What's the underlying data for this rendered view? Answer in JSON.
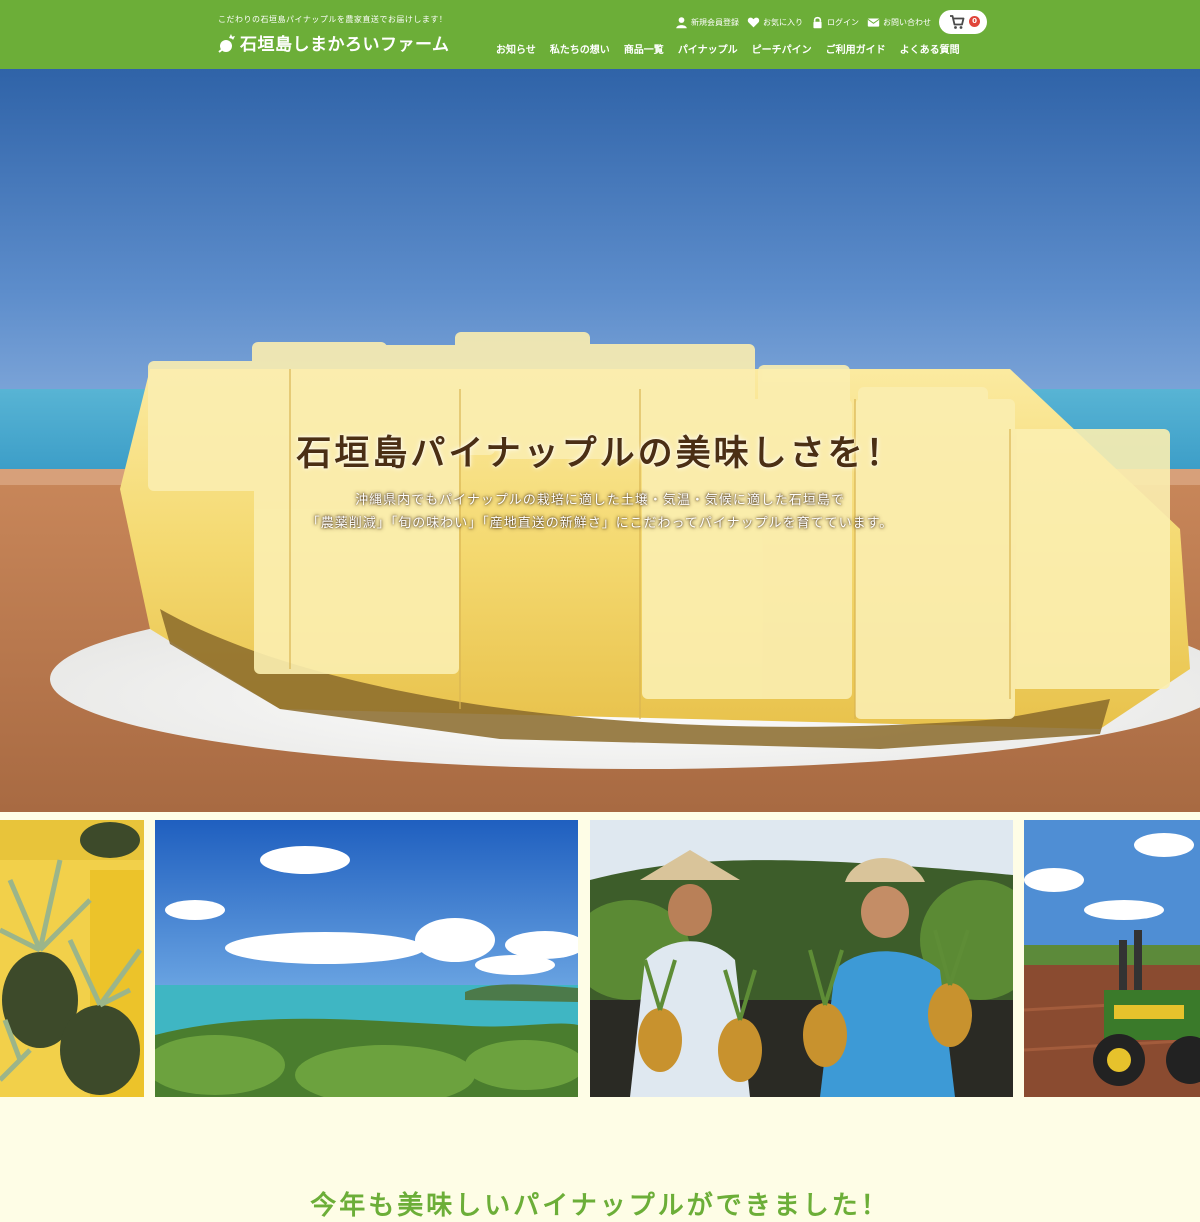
{
  "header": {
    "tagline": "こだわりの石垣島パイナップルを農家直送でお届けします！",
    "logo_text": "石垣島しまかろいファーム",
    "utility": [
      {
        "label": "新規会員登録",
        "icon": "user-icon"
      },
      {
        "label": "お気に入り",
        "icon": "heart-icon"
      },
      {
        "label": "ログイン",
        "icon": "lock-icon"
      },
      {
        "label": "お問い合わせ",
        "icon": "envelope-icon"
      }
    ],
    "cart_count": "0"
  },
  "nav": [
    {
      "label": "お知らせ"
    },
    {
      "label": "私たちの想い"
    },
    {
      "label": "商品一覧"
    },
    {
      "label": "パイナップル"
    },
    {
      "label": "ピーチパイン"
    },
    {
      "label": "ご利用ガイド"
    },
    {
      "label": "よくある質問"
    }
  ],
  "hero": {
    "title": "石垣島パイナップルの美味しさを！",
    "line1": "沖縄県内でもパイナップルの栽培に適した土壌・気温・気候に適した石垣島で",
    "line2": "「農薬削減」「旬の味わい」「産地直送の新鮮さ」にこだわってパイナップルを育てています。"
  },
  "gallery": [
    {
      "icon": "pineapple-crates-photo"
    },
    {
      "icon": "ocean-coast-photo"
    },
    {
      "icon": "farmers-photo"
    },
    {
      "icon": "tractor-field-photo"
    }
  ],
  "next_heading": "今年も美味しいパイナップルができました！",
  "colors": {
    "brand_green": "#6cae38",
    "background": "#fefde6",
    "cart_badge": "#e0453a",
    "title_brown": "#4b2f14"
  }
}
